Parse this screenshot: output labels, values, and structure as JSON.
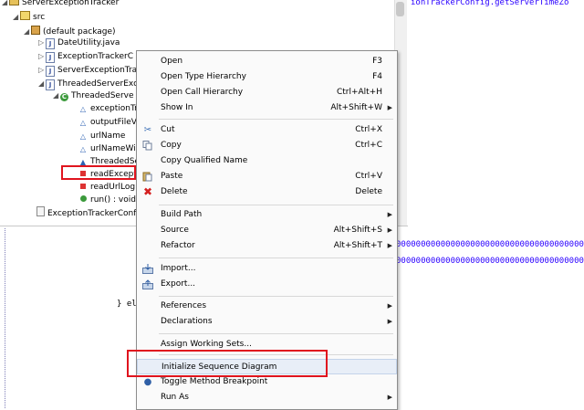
{
  "editor_top_text": "ionTrackerConfig.getServerTimeZo",
  "explorer": {
    "rows": [
      {
        "label": "ServerExceptionTracker"
      },
      {
        "label": "src"
      },
      {
        "label": "(default package)"
      },
      {
        "label": "DateUtility.java"
      },
      {
        "label": "ExceptionTrackerC"
      },
      {
        "label": "ServerExceptionTra"
      },
      {
        "label": "ThreadedServerExc"
      },
      {
        "label": "ThreadedServe"
      },
      {
        "label": "exceptionTr"
      },
      {
        "label": "outputFileV"
      },
      {
        "label": "urlName"
      },
      {
        "label": "urlNameWi"
      },
      {
        "label": "ThreadedSe"
      },
      {
        "label": "readExcept"
      },
      {
        "label": "readUrlLog"
      },
      {
        "label": "run() : void"
      },
      {
        "label": "ExceptionTrackerConf"
      }
    ]
  },
  "code": {
    "line1": "0000000000000000000000000000000000000000",
    "line2": "0000000000000000000000000000000000000000",
    "brace": "} el"
  },
  "menu": {
    "open": {
      "label": "Open",
      "shortcut": "F3"
    },
    "open_type_hierarchy": {
      "label": "Open Type Hierarchy",
      "shortcut": "F4"
    },
    "open_call_hierarchy": {
      "label": "Open Call Hierarchy",
      "shortcut": "Ctrl+Alt+H"
    },
    "show_in": {
      "label": "Show In",
      "shortcut": "Alt+Shift+W"
    },
    "cut": {
      "label": "Cut",
      "shortcut": "Ctrl+X"
    },
    "copy": {
      "label": "Copy",
      "shortcut": "Ctrl+C"
    },
    "copy_qualified_name": {
      "label": "Copy Qualified Name"
    },
    "paste": {
      "label": "Paste",
      "shortcut": "Ctrl+V"
    },
    "delete": {
      "label": "Delete",
      "shortcut": "Delete"
    },
    "build_path": {
      "label": "Build Path"
    },
    "source": {
      "label": "Source",
      "shortcut": "Alt+Shift+S"
    },
    "refactor": {
      "label": "Refactor",
      "shortcut": "Alt+Shift+T"
    },
    "import": {
      "label": "Import..."
    },
    "export": {
      "label": "Export..."
    },
    "references": {
      "label": "References"
    },
    "declarations": {
      "label": "Declarations"
    },
    "assign_working_sets": {
      "label": "Assign Working Sets..."
    },
    "initialize_sequence_diagram": {
      "label": "Initialize Sequence Diagram"
    },
    "toggle_method_breakpoint": {
      "label": "Toggle Method Breakpoint"
    },
    "run_as": {
      "label": "Run As"
    }
  }
}
